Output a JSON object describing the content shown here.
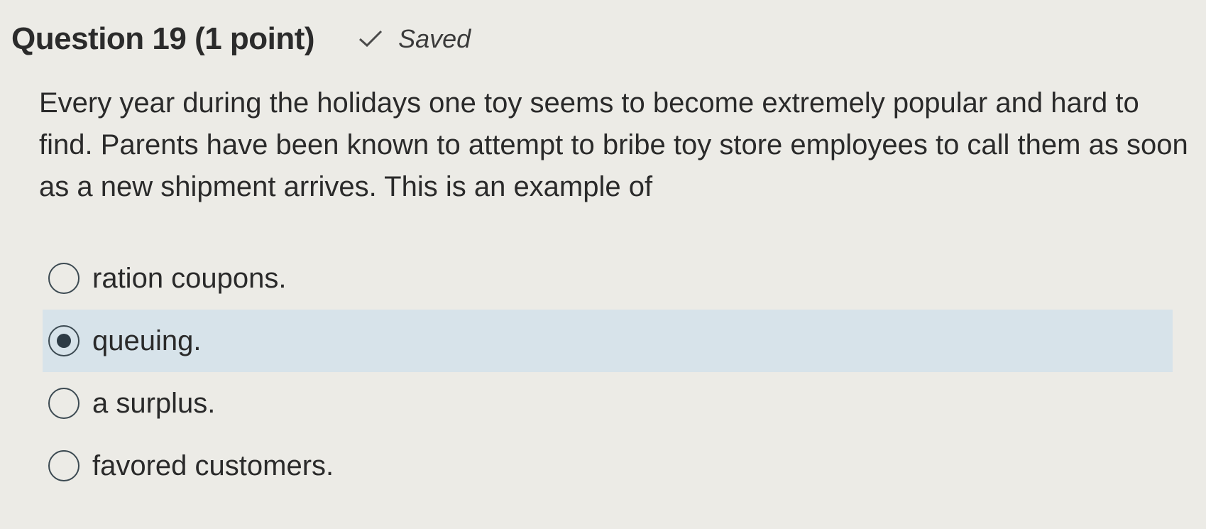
{
  "question": {
    "title": "Question 19 (1 point)",
    "status": "Saved",
    "status_icon": "checkmark-icon",
    "text": "Every year during the holidays one toy seems to become extremely popular and hard to find. Parents have been known to attempt to bribe toy store employees to call them as soon as a new shipment arrives. This is an example of",
    "selected_answer": "queuing.",
    "answers": [
      {
        "label": "ration coupons.",
        "selected": false
      },
      {
        "label": "queuing.",
        "selected": true
      },
      {
        "label": "a surplus.",
        "selected": false
      },
      {
        "label": "favored customers.",
        "selected": false
      }
    ]
  },
  "colors": {
    "background": "#ecebe6",
    "selected_background": "#d7e3ea",
    "text": "#2a2a2a",
    "radio": "#2d3b45"
  }
}
